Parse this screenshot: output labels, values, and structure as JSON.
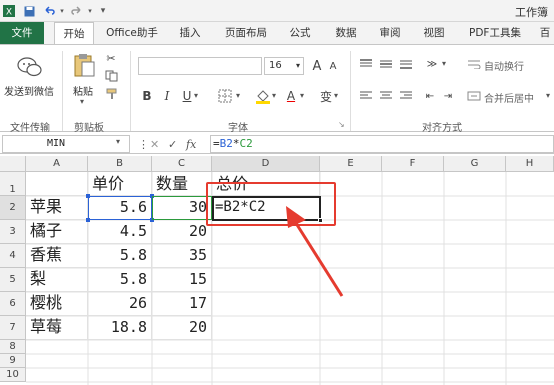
{
  "title_bar": {
    "title": "工作簿",
    "quick_access": [
      "save-icon",
      "undo-icon",
      "redo-icon",
      "customize-icon"
    ]
  },
  "tabs": [
    "文件",
    "开始",
    "Office助手",
    "插入",
    "页面布局",
    "公式",
    "数据",
    "审阅",
    "视图",
    "PDF工具集",
    "百"
  ],
  "ribbon": {
    "send_wechat_label": "发送到微信",
    "paste_label": "粘贴",
    "font_size": "16",
    "wrap_text_label": "自动换行",
    "merge_center_label": "合并后居中",
    "bold": "B",
    "italic": "I",
    "underline": "U",
    "increase_font": "A",
    "decrease_font": "A",
    "font_color": "A",
    "phonetic": "变",
    "groups": [
      "文件传输",
      "剪贴板",
      "字体",
      "对齐方式"
    ]
  },
  "formula_bar": {
    "name_box": "MIN",
    "formula": "=B2*C2",
    "formula_ref1": "B2",
    "formula_op": "*",
    "formula_ref2": "C2",
    "fx_label": "fx",
    "cancel": "✕",
    "confirm": "✓"
  },
  "grid": {
    "columns": [
      "A",
      "B",
      "C",
      "D",
      "E",
      "F",
      "G",
      "H"
    ],
    "rows": [
      "1",
      "2",
      "3",
      "4",
      "5",
      "6",
      "7",
      "8",
      "9",
      "10"
    ],
    "headers": [
      "单价",
      "数量",
      "总价"
    ],
    "data": [
      [
        "苹果",
        "5.6",
        "30"
      ],
      [
        "橘子",
        "4.5",
        "20"
      ],
      [
        "香蕉",
        "5.8",
        "35"
      ],
      [
        "梨",
        "5.8",
        "15"
      ],
      [
        "樱桃",
        "26",
        "17"
      ],
      [
        "草莓",
        "18.8",
        "20"
      ]
    ],
    "d2_formula": "=B2*C2"
  },
  "colors": {
    "excel_green": "#217346",
    "highlight_red": "#e53b2f",
    "ref_blue": "#2b62d6",
    "ref_green": "#2b9a3c"
  }
}
